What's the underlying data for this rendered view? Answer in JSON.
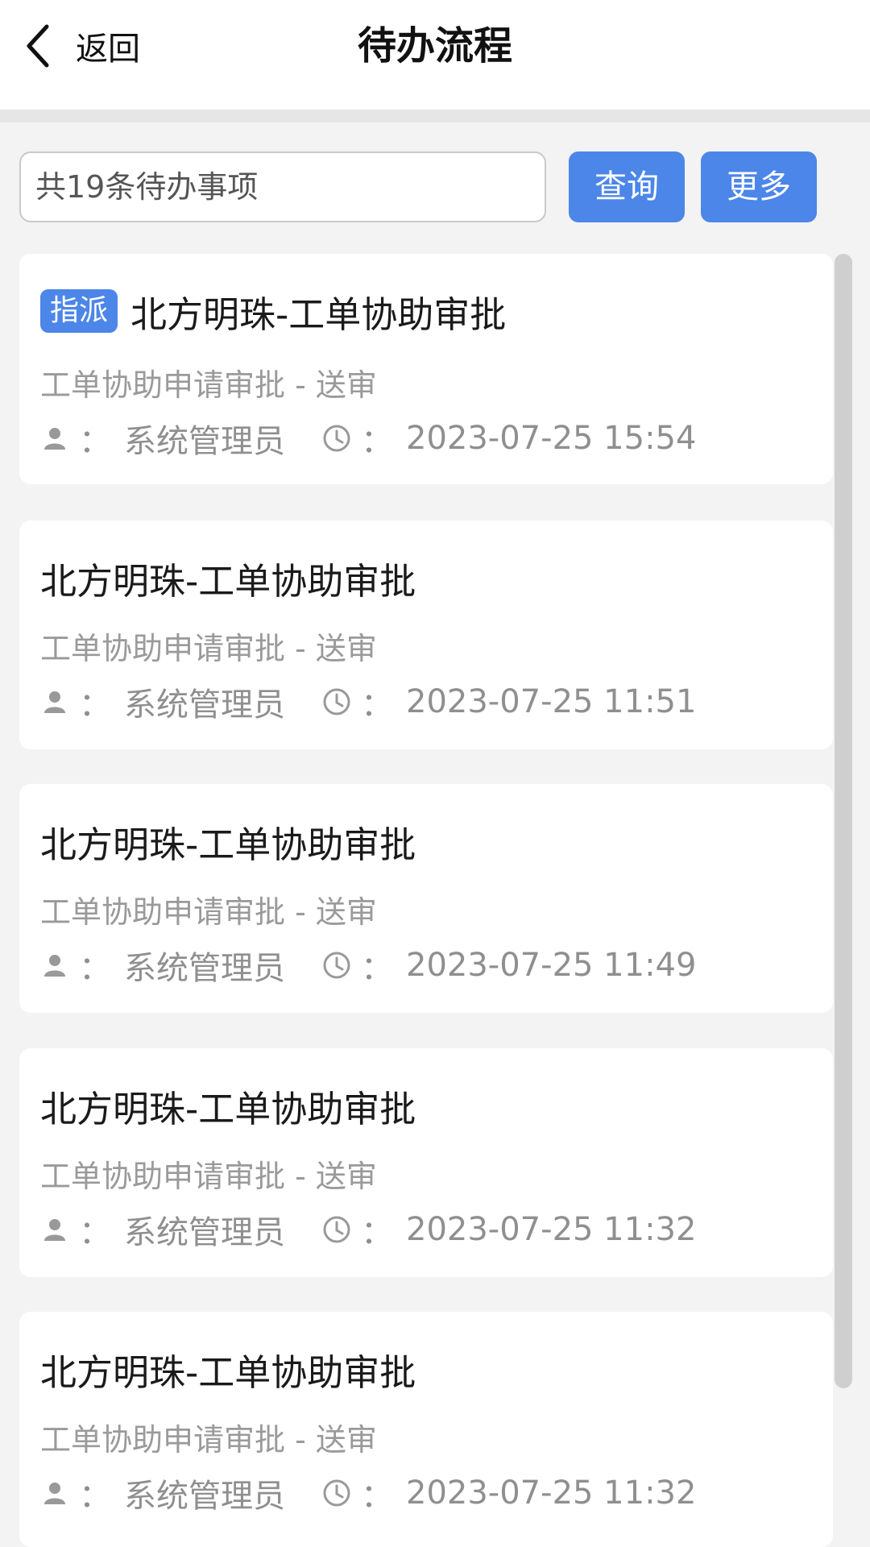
{
  "header": {
    "back_label": "返回",
    "title": "待办流程"
  },
  "search": {
    "placeholder": "共19条待办事项",
    "value": ""
  },
  "toolbar": {
    "query_label": "查询",
    "more_label": "更多"
  },
  "colors": {
    "accent": "#4c86e8",
    "background": "#f3f3f3",
    "card": "#ffffff"
  },
  "items": [
    {
      "tag": "指派",
      "title": "北方明珠-工单协助审批",
      "subtitle": "工单协助申请审批 - 送审",
      "user": "系统管理员",
      "time": "2023-07-25 15:54"
    },
    {
      "title": "北方明珠-工单协助审批",
      "subtitle": "工单协助申请审批 - 送审",
      "user": "系统管理员",
      "time": "2023-07-25 11:51"
    },
    {
      "title": "北方明珠-工单协助审批",
      "subtitle": "工单协助申请审批 - 送审",
      "user": "系统管理员",
      "time": "2023-07-25 11:49"
    },
    {
      "title": "北方明珠-工单协助审批",
      "subtitle": "工单协助申请审批 - 送审",
      "user": "系统管理员",
      "time": "2023-07-25 11:32"
    },
    {
      "title": "北方明珠-工单协助审批",
      "subtitle": "工单协助申请审批 - 送审",
      "user": "系统管理员",
      "time": "2023-07-25 11:32"
    }
  ],
  "icons": {
    "back": "chevron-left-icon",
    "user": "user-icon",
    "time": "clock-icon"
  },
  "colon": "："
}
